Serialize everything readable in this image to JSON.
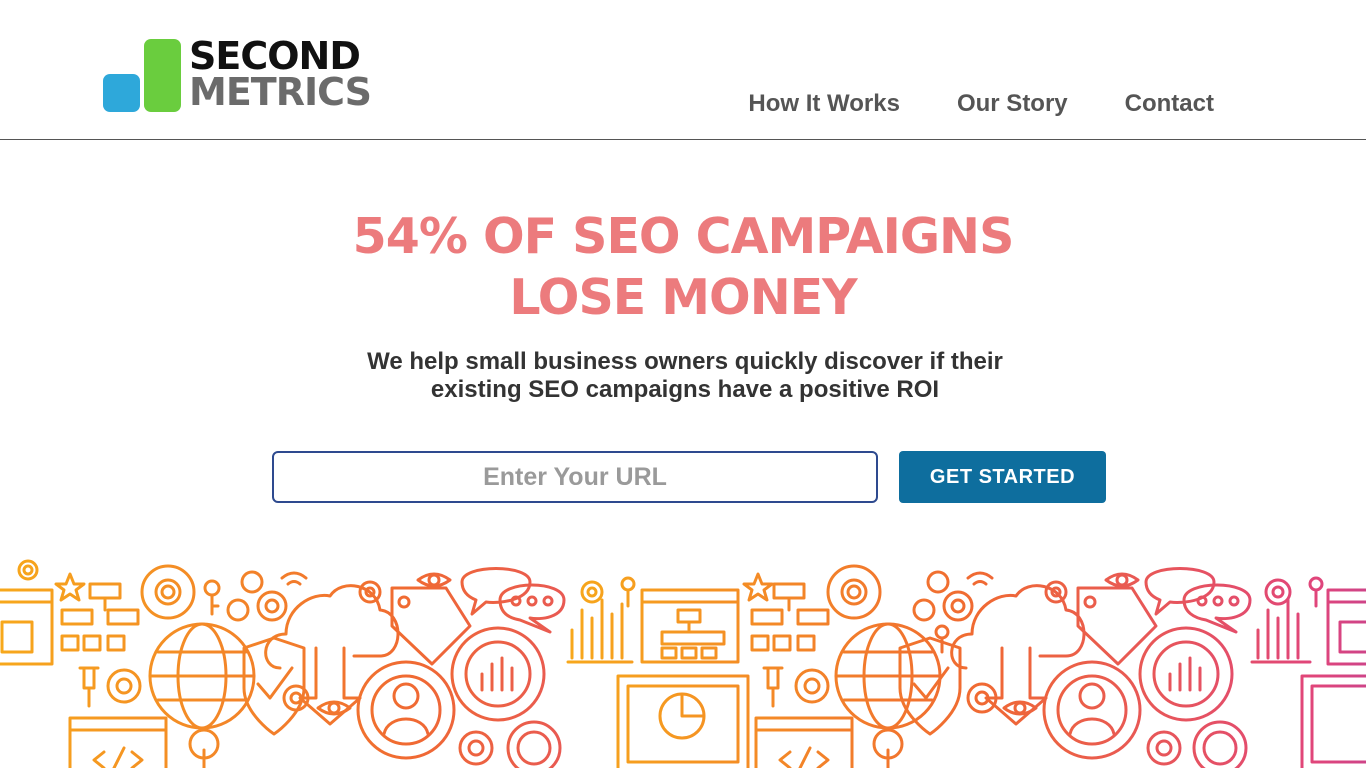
{
  "brand": {
    "line1": "SECOND",
    "line2": "METRICS"
  },
  "nav": {
    "items": [
      "How It Works",
      "Our Story",
      "Contact"
    ]
  },
  "hero": {
    "title_line1": "54% OF SEO CAMPAIGNS",
    "title_line2": "LOSE MONEY",
    "subtitle_line1": "We help small business owners quickly discover if their",
    "subtitle_line2": "existing SEO campaigns have a positive ROI"
  },
  "form": {
    "url_placeholder": "Enter Your URL",
    "url_value": "",
    "cta_label": "GET STARTED"
  },
  "colors": {
    "title": "#ec7b7d",
    "cta_bg": "#0e6e9e",
    "input_border": "#2e4a8f",
    "logo_blue": "#2ea8da",
    "logo_green": "#6acd3e",
    "gradient": [
      "#f7a81b",
      "#f06a32",
      "#e0457b",
      "#8b3fb8",
      "#2f4fd8",
      "#1f7ae0"
    ]
  },
  "illustration": {
    "icons": [
      "gear-icon",
      "org-chart-icon",
      "globe-icon",
      "shield-check-icon",
      "cloud-download-icon",
      "tag-icon",
      "chat-bubble-icon",
      "bar-chart-icon",
      "browser-window-icon",
      "pie-chart-icon",
      "webcam-icon",
      "eye-icon",
      "key-icon",
      "star-icon",
      "pushpin-icon",
      "code-window-icon",
      "user-target-icon",
      "wifi-icon"
    ]
  }
}
